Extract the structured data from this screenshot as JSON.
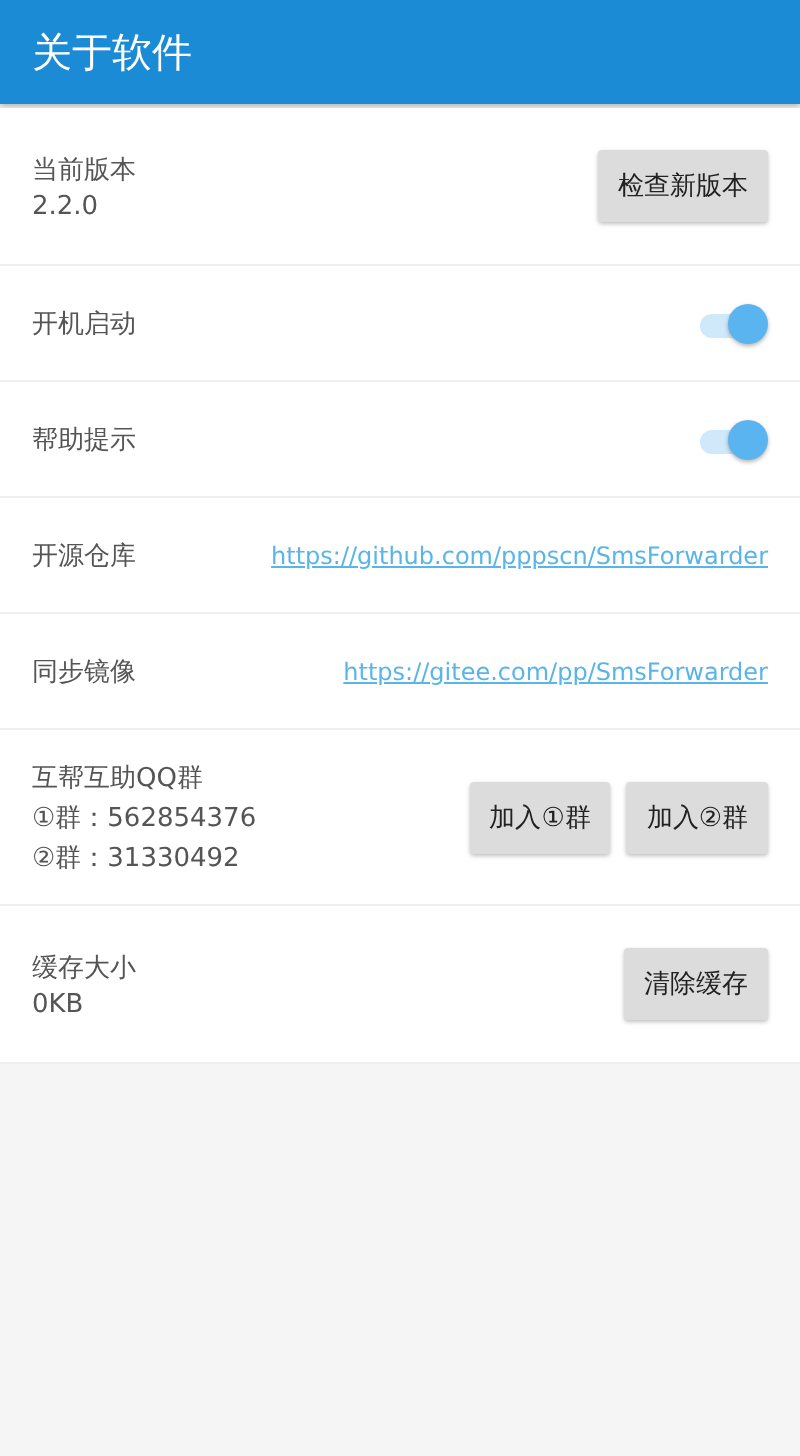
{
  "title": "关于软件",
  "rows": [
    {
      "kind": "info",
      "label": "当前版本",
      "lines": [
        "2.2.0"
      ],
      "buttons": [
        "检查新版本"
      ]
    },
    {
      "kind": "switch",
      "label": "开机启动",
      "on": true
    },
    {
      "kind": "switch",
      "label": "帮助提示",
      "on": true
    },
    {
      "kind": "link",
      "label": "开源仓库",
      "link": "https://github.com/pppscn/SmsForwarder"
    },
    {
      "kind": "link",
      "label": "同步镜像",
      "link": "https://gitee.com/pp/SmsForwarder"
    },
    {
      "kind": "info",
      "label": "互帮互助QQ群",
      "lines": [
        "①群：562854376",
        "②群：31330492"
      ],
      "buttons": [
        "加入①群",
        "加入②群"
      ]
    },
    {
      "kind": "info",
      "label": "缓存大小",
      "lines": [
        "0KB"
      ],
      "buttons": [
        "清除缓存"
      ]
    }
  ]
}
